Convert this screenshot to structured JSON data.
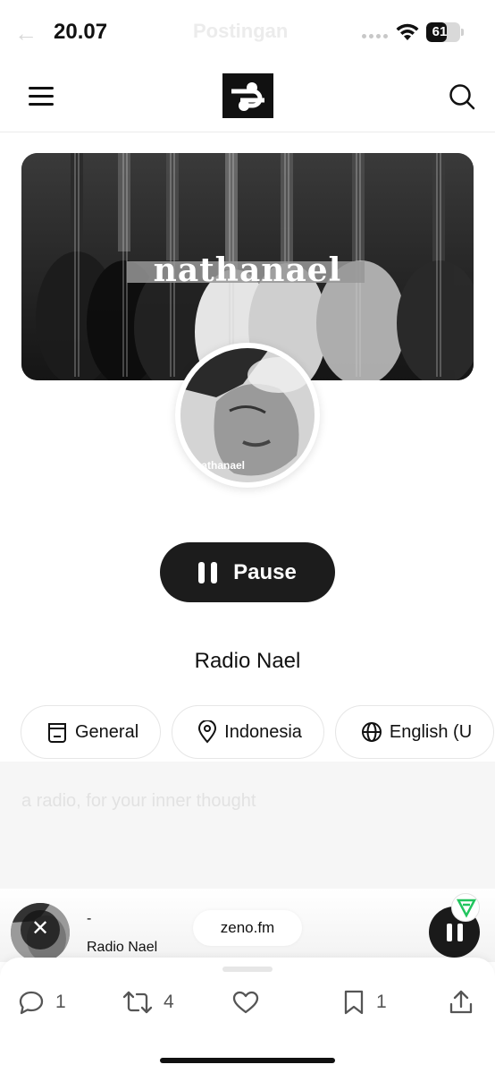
{
  "status_bar": {
    "time": "20.07",
    "ghost_title": "Postingan",
    "battery": "61",
    "battery_level": 0.61
  },
  "banner": {
    "title": "nathanael"
  },
  "avatar": {
    "caption": "nathanael"
  },
  "player_controls": {
    "pause_label": "Pause"
  },
  "station": {
    "name": "Radio Nael",
    "description": "a radio, for your inner thought"
  },
  "chips": [
    {
      "icon": "radio-icon",
      "label": "General"
    },
    {
      "icon": "location-pin-icon",
      "label": "Indonesia"
    },
    {
      "icon": "globe-icon",
      "label": "English (U"
    }
  ],
  "mini_player": {
    "track": "-",
    "station": "Radio Nael",
    "source": "zeno.fm"
  },
  "post_actions": {
    "replies": "1",
    "reposts": "4",
    "bookmarks": "1"
  },
  "colors": {
    "accent": "#1c1c1c",
    "badge": "#22c55e"
  }
}
